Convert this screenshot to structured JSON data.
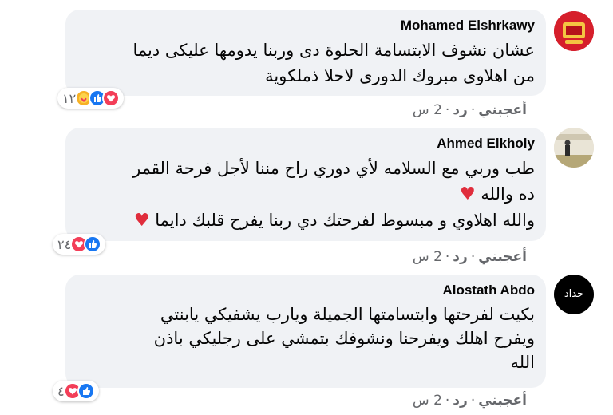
{
  "comments": [
    {
      "author": "Mohamed Elshrkawy",
      "text": "عشان نشوف الابتسامة الحلوة دى وربنا يدومها عليكى ديما\nمن اهلاوى مبروك الدورى لاحلا ذملكوية",
      "reaction_count": "١٢",
      "reactions": [
        "love-icon",
        "like-icon",
        "care-icon"
      ],
      "actions": {
        "like": "أعجبني",
        "reply": "رد",
        "time": "2 س"
      }
    },
    {
      "author": "Ahmed Elkholy",
      "text_line1": "طب وربي مع السلامه لأي دوري راح مننا لأجل فرحة القمر",
      "text_line2": "ده والله",
      "text_line3": "والله اهلاوي و مبسوط لفرحتك دي ربنا يفرح قلبك دايما",
      "reaction_count": "٢٤",
      "reactions": [
        "like-icon",
        "love-icon"
      ],
      "actions": {
        "like": "أعجبني",
        "reply": "رد",
        "time": "2 س"
      }
    },
    {
      "author": "Alostath Abdo",
      "text": "بكيت لفرحتها وابتسامتها الجميلة ويارب يشفيكي يابنتي\nويفرح اهلك ويفرحنا ونشوفك بتمشي على رجليكي باذن\nالله",
      "avatar_text": "حداد",
      "reaction_count": "٤",
      "reactions": [
        "like-icon",
        "love-icon"
      ],
      "actions": {
        "like": "أعجبني",
        "reply": "رد",
        "time": "2 س"
      }
    }
  ],
  "colors": {
    "bubble": "#f0f2f5",
    "like": "#1877f2",
    "love": "#f33e58",
    "care": "#f7b125",
    "meta": "#65676b"
  }
}
